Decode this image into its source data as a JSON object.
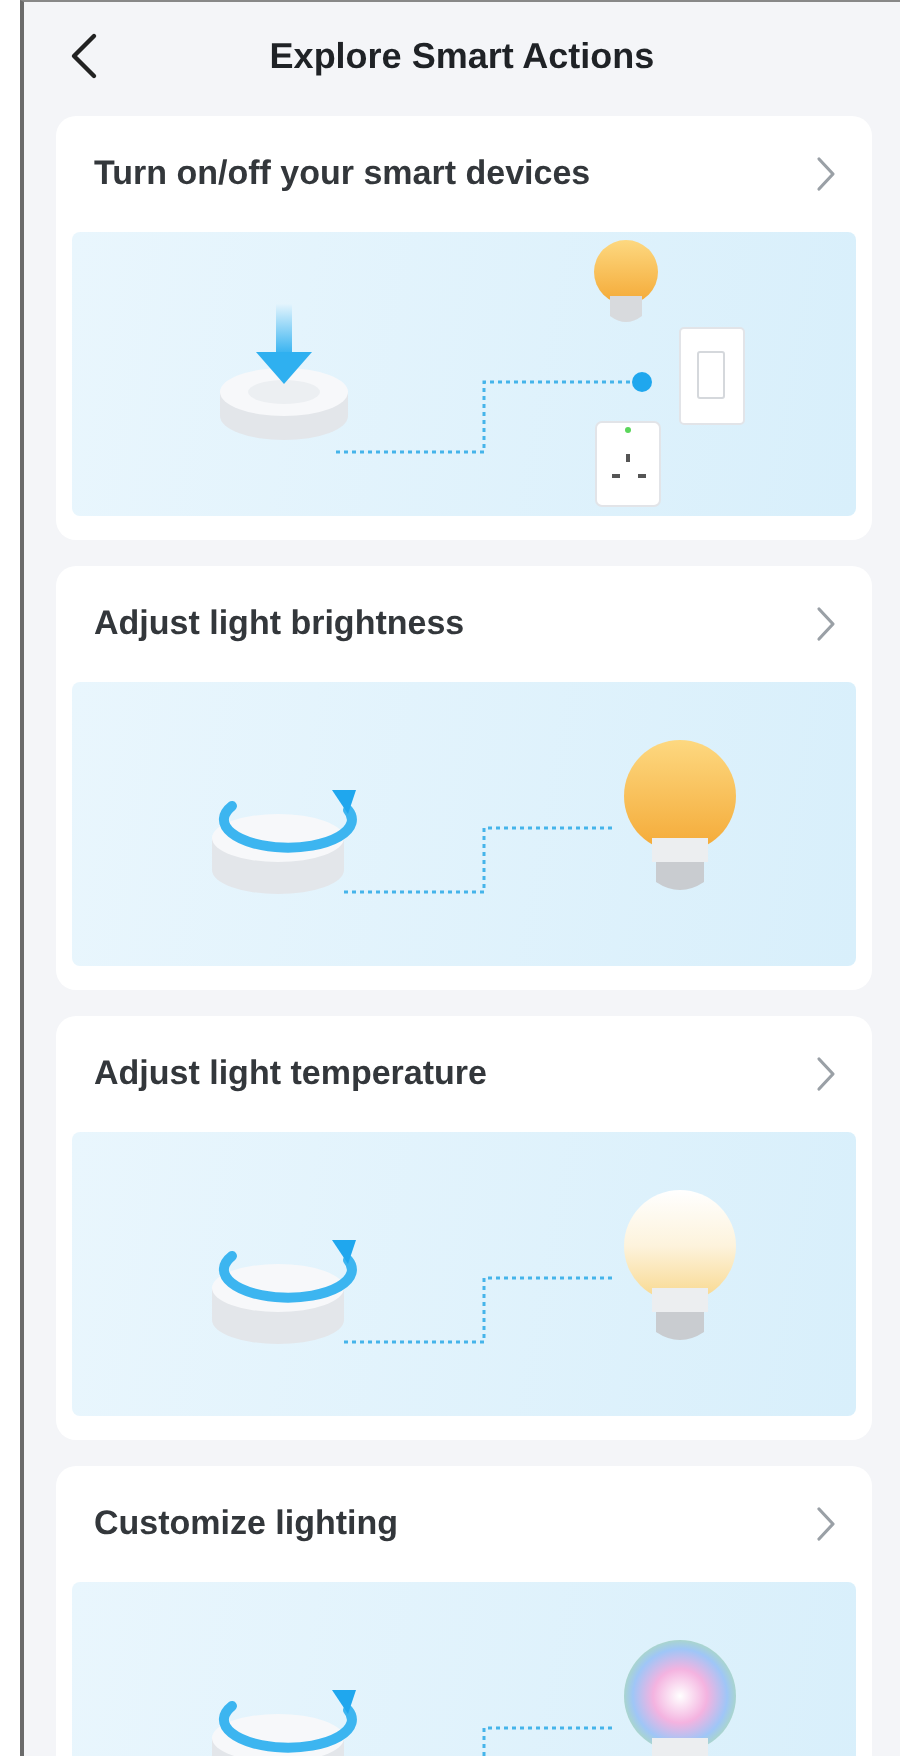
{
  "header": {
    "title": "Explore Smart Actions"
  },
  "actions": [
    {
      "title": "Turn on/off your smart devices",
      "kind": "switch"
    },
    {
      "title": "Adjust light brightness",
      "kind": "brightness"
    },
    {
      "title": "Adjust light temperature",
      "kind": "temperature"
    },
    {
      "title": "Customize lighting",
      "kind": "color"
    }
  ]
}
